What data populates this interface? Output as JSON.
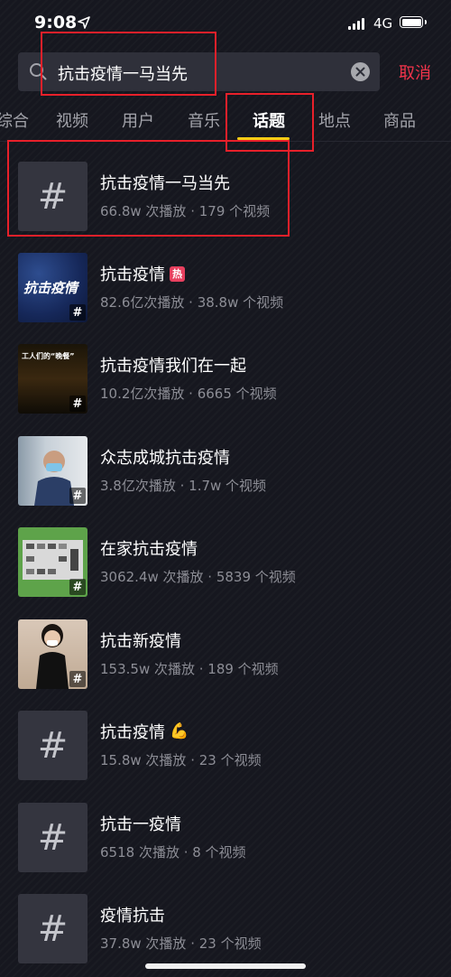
{
  "status_bar": {
    "time": "9:08",
    "network": "4G"
  },
  "search": {
    "query": "抗击疫情一马当先",
    "cancel_label": "取消"
  },
  "tabs": [
    {
      "label": "综合",
      "active": false
    },
    {
      "label": "视频",
      "active": false
    },
    {
      "label": "用户",
      "active": false
    },
    {
      "label": "音乐",
      "active": false
    },
    {
      "label": "话题",
      "active": true
    },
    {
      "label": "地点",
      "active": false
    },
    {
      "label": "商品",
      "active": false
    }
  ],
  "topics": [
    {
      "title": "抗击疫情一马当先",
      "meta": "66.8w 次播放 · 179 个视频",
      "thumb": "hashtag-placeholder"
    },
    {
      "title": "抗击疫情",
      "badge": "热",
      "meta": "82.6亿次播放 · 38.8w 个视频",
      "thumb": "image",
      "thumb_text": "抗击疫情"
    },
    {
      "title": "抗击疫情我们在一起",
      "meta": "10.2亿次播放 · 6665 个视频",
      "thumb": "image",
      "thumb_text": "工人们的“晚餐”"
    },
    {
      "title": "众志成城抗击疫情",
      "meta": "3.8亿次播放 · 1.7w 个视频",
      "thumb": "image"
    },
    {
      "title": "在家抗击疫情",
      "meta": "3062.4w 次播放 · 5839 个视频",
      "thumb": "image"
    },
    {
      "title": "抗击新疫情",
      "meta": "153.5w 次播放 · 189 个视频",
      "thumb": "image"
    },
    {
      "title": "抗击疫情",
      "emoji": "💪",
      "meta": "15.8w 次播放 · 23 个视频",
      "thumb": "hashtag-placeholder"
    },
    {
      "title": "抗击一疫情",
      "meta": "6518 次播放 · 8 个视频",
      "thumb": "hashtag-placeholder"
    },
    {
      "title": "疫情抗击",
      "meta": "37.8w 次播放 · 23 个视频",
      "thumb": "hashtag-placeholder"
    }
  ],
  "icons": {
    "hashtag": "#",
    "search": "search-icon",
    "clear": "clear-icon",
    "location": "location-arrow-icon"
  },
  "colors": {
    "background": "#16171f",
    "accent_cancel": "#f2344b",
    "tab_underline": "#facc15",
    "hot_badge": "#e8405f",
    "annotation": "#e8202a"
  }
}
